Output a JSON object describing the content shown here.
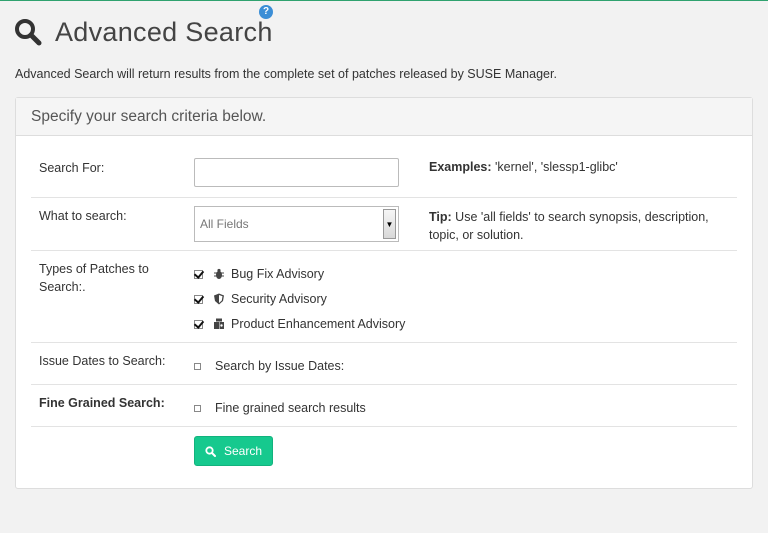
{
  "header": {
    "title": "Advanced Search",
    "help": "?"
  },
  "intro": "Advanced Search will return results from the complete set of patches released by SUSE Manager.",
  "panel": {
    "heading": "Specify your search criteria below.",
    "search_for": {
      "label": "Search For:",
      "value": "",
      "examples_label": "Examples:",
      "examples_text": " 'kernel', 'slessp1-glibc'"
    },
    "what_to_search": {
      "label": "What to search:",
      "selected": "All Fields",
      "tip_label": "Tip:",
      "tip_text": " Use 'all fields' to search synopsis, description, topic, or solution."
    },
    "patch_types": {
      "label_line1": "Types of Patches to",
      "label_line2": "Search:.",
      "options": [
        {
          "label": "Bug Fix Advisory",
          "icon": "bug-icon",
          "checked": true
        },
        {
          "label": "Security Advisory",
          "icon": "shield-icon",
          "checked": true
        },
        {
          "label": "Product Enhancement Advisory",
          "icon": "puzzle-icon",
          "checked": true
        }
      ]
    },
    "issue_dates": {
      "label": "Issue Dates to Search:",
      "option": "Search by Issue Dates:",
      "checked": false
    },
    "fine_grained": {
      "label": "Fine Grained Search:",
      "option": "Fine grained search results",
      "checked": false
    },
    "search_button": "Search"
  },
  "colors": {
    "accent": "#16c98e",
    "help": "#3b8ed6",
    "top_border": "#2fa26f"
  }
}
